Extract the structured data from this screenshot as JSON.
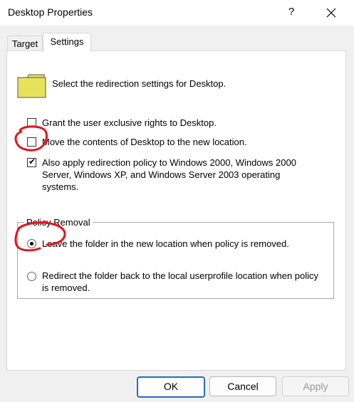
{
  "window": {
    "title": "Desktop Properties",
    "help_symbol": "?",
    "close_icon": "close-icon"
  },
  "tabs": [
    {
      "label": "Target",
      "selected": false
    },
    {
      "label": "Settings",
      "selected": true
    }
  ],
  "header": {
    "icon": "folder-icon",
    "text": "Select the redirection settings for Desktop."
  },
  "options": {
    "exclusive_rights": {
      "label": "Grant the user exclusive rights to Desktop.",
      "checked": false
    },
    "move_contents": {
      "label": "Move the contents of Desktop to the new location.",
      "checked": false
    },
    "apply_policy": {
      "label_line1": "Also apply redirection policy to Windows 2000, Windows 2000",
      "label_line2": "Server, Windows XP, and Windows Server 2003 operating",
      "label_line3": "systems.",
      "checked": true
    }
  },
  "policy_removal": {
    "legend": "Policy Removal",
    "leave_folder": {
      "label": "Leave the folder in the new location when policy is removed.",
      "selected": true
    },
    "redirect_back": {
      "label_line1": "Redirect the folder back to the local userprofile location when policy",
      "label_line2": "is removed.",
      "selected": false
    }
  },
  "buttons": {
    "ok": "OK",
    "cancel": "Cancel",
    "apply": "Apply"
  },
  "colors": {
    "annotation": "#e0161b",
    "ok_border": "#1e6fbf",
    "folder_fill": "#e6e35a"
  }
}
